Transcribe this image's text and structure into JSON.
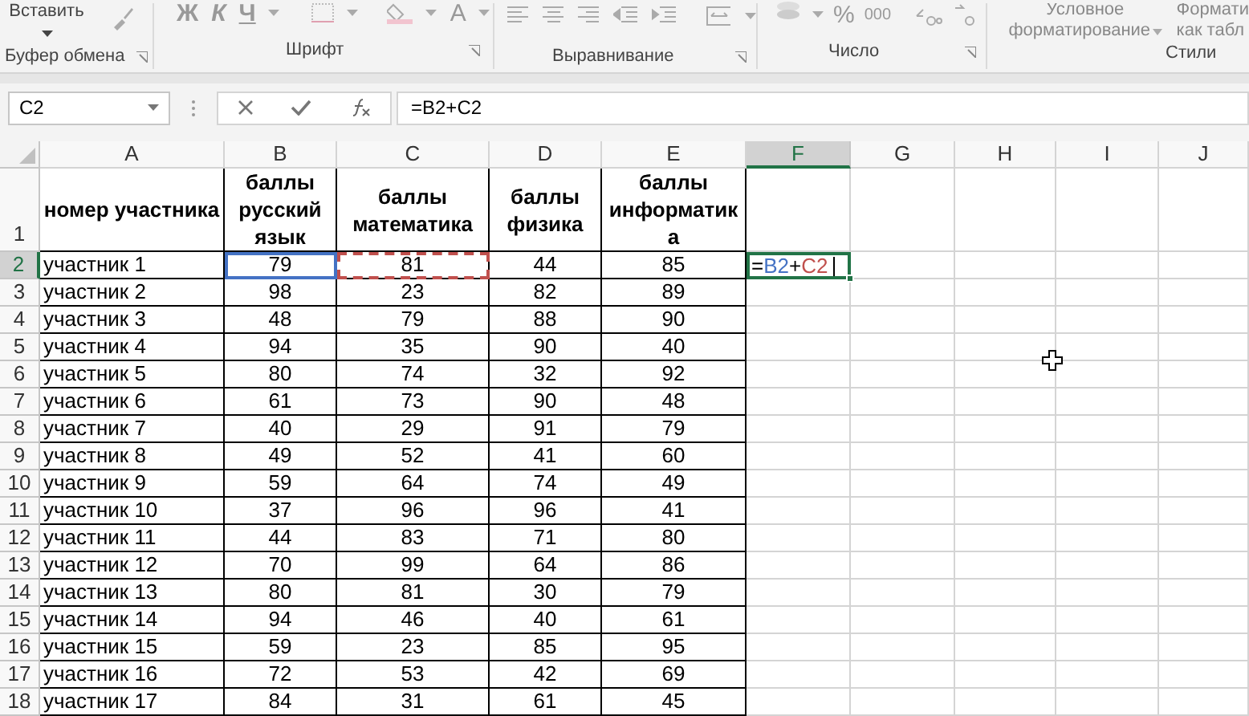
{
  "ribbon": {
    "clipboard": {
      "paste_label": "Вставить",
      "group": "Буфер обмена"
    },
    "font": {
      "style_buttons": [
        "Ж",
        "К",
        "Ч"
      ],
      "color_letter": "A",
      "group": "Шрифт"
    },
    "alignment": {
      "group": "Выравнивание"
    },
    "number": {
      "percent": "%",
      "thousands": "000",
      "group": "Число"
    },
    "styles": {
      "conditional": [
        "Условное",
        "форматирование"
      ],
      "table_format": [
        "Формати",
        "как табл"
      ],
      "group": "Стили"
    }
  },
  "name_box": "C2",
  "formula": "=B2+C2",
  "columns": [
    {
      "label": "A",
      "selected": false
    },
    {
      "label": "B",
      "selected": false
    },
    {
      "label": "C",
      "selected": false
    },
    {
      "label": "D",
      "selected": false
    },
    {
      "label": "E",
      "selected": false
    },
    {
      "label": "F",
      "selected": true
    },
    {
      "label": "G",
      "selected": false
    },
    {
      "label": "H",
      "selected": false
    },
    {
      "label": "I",
      "selected": false
    },
    {
      "label": "J",
      "selected": false
    }
  ],
  "row_headers": [
    {
      "label": "1",
      "selected": false
    },
    {
      "label": "2",
      "selected": true
    },
    {
      "label": "3",
      "selected": false
    },
    {
      "label": "4",
      "selected": false
    },
    {
      "label": "5",
      "selected": false
    },
    {
      "label": "6",
      "selected": false
    },
    {
      "label": "7",
      "selected": false
    },
    {
      "label": "8",
      "selected": false
    },
    {
      "label": "9",
      "selected": false
    },
    {
      "label": "10",
      "selected": false
    },
    {
      "label": "11",
      "selected": false
    },
    {
      "label": "12",
      "selected": false
    },
    {
      "label": "13",
      "selected": false
    },
    {
      "label": "14",
      "selected": false
    },
    {
      "label": "15",
      "selected": false
    },
    {
      "label": "16",
      "selected": false
    },
    {
      "label": "17",
      "selected": false
    },
    {
      "label": "18",
      "selected": false
    }
  ],
  "header_row": [
    "номер участника",
    "баллы русский язык",
    "баллы математика",
    "баллы физика",
    "баллы информатика"
  ],
  "data_rows": [
    {
      "cells": [
        "участник 1",
        {
          "kind": "solid_reference",
          "text": "79",
          "color": "#4472c4"
        },
        {
          "kind": "dashed_reference",
          "text": "81",
          "color": "#c0504d"
        },
        "44",
        "85",
        {
          "kind": "editor",
          "parts": [
            {
              "text": "=",
              "color": "#000000"
            },
            {
              "text": "B2",
              "color": "#4472c4"
            },
            {
              "text": "+",
              "color": "#000000"
            },
            {
              "text": "C2",
              "color": "#c0504d"
            }
          ]
        }
      ]
    },
    {
      "cells": [
        "участник 2",
        "98",
        "23",
        "82",
        "89"
      ]
    },
    {
      "cells": [
        "участник 3",
        "48",
        "79",
        "88",
        "90"
      ]
    },
    {
      "cells": [
        "участник 4",
        "94",
        "35",
        "90",
        "40"
      ]
    },
    {
      "cells": [
        "участник 5",
        "80",
        "74",
        "32",
        "92"
      ]
    },
    {
      "cells": [
        "участник 6",
        "61",
        "73",
        "90",
        "48"
      ]
    },
    {
      "cells": [
        "участник 7",
        "40",
        "29",
        "91",
        "79"
      ]
    },
    {
      "cells": [
        "участник 8",
        "49",
        "52",
        "41",
        "60"
      ]
    },
    {
      "cells": [
        "участник 9",
        "59",
        "64",
        "74",
        "49"
      ]
    },
    {
      "cells": [
        "участник 10",
        "37",
        "96",
        "96",
        "41"
      ]
    },
    {
      "cells": [
        "участник 11",
        "44",
        "83",
        "71",
        "80"
      ]
    },
    {
      "cells": [
        "участник 12",
        "70",
        "99",
        "64",
        "86"
      ]
    },
    {
      "cells": [
        "участник 13",
        "80",
        "81",
        "30",
        "79"
      ]
    },
    {
      "cells": [
        "участник 14",
        "94",
        "46",
        "40",
        "61"
      ]
    },
    {
      "cells": [
        "участник 15",
        "59",
        "23",
        "85",
        "95"
      ]
    },
    {
      "cells": [
        "участник 16",
        "72",
        "53",
        "42",
        "69"
      ]
    },
    {
      "cells": [
        "участник 17",
        "84",
        "31",
        "61",
        "45"
      ]
    }
  ]
}
